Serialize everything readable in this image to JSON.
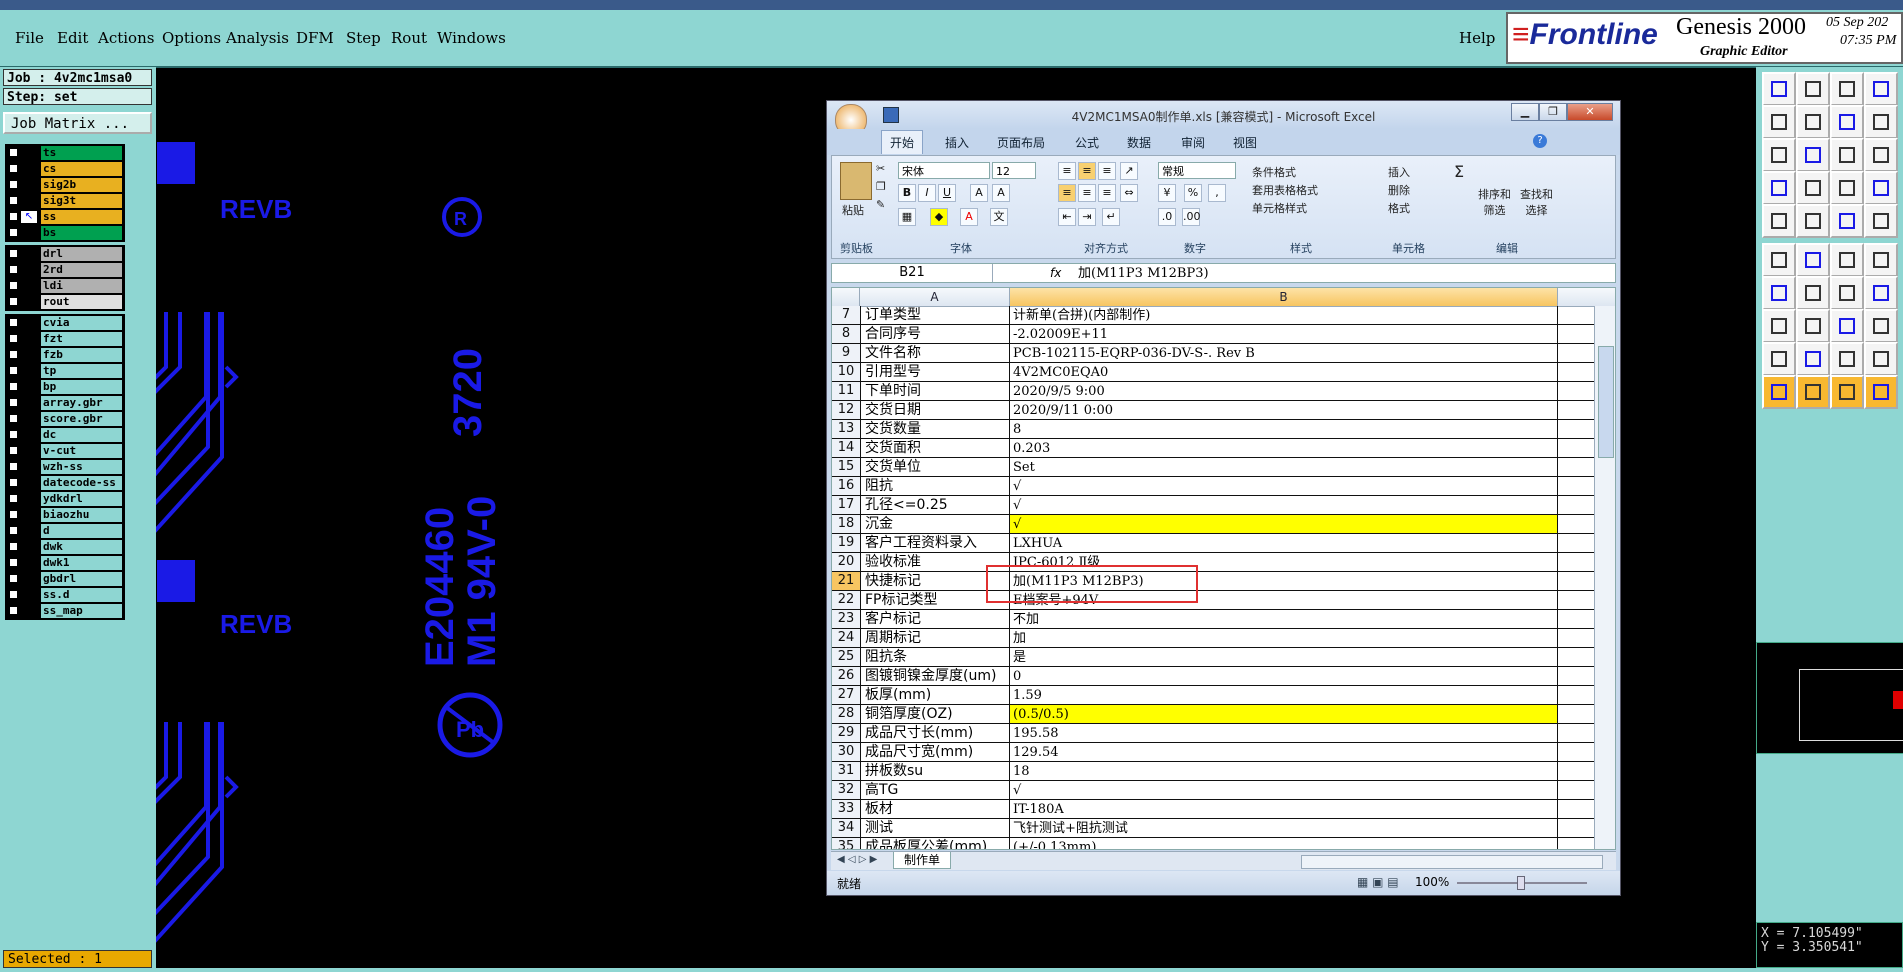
{
  "genesis": {
    "menu": [
      "File",
      "Edit",
      "Actions",
      "Options",
      "Analysis",
      "DFM",
      "Step",
      "Rout",
      "Windows"
    ],
    "help": "Help",
    "brand": {
      "logo": "Frontline",
      "product": "Genesis 2000",
      "subtitle": "Graphic Editor",
      "date": "05 Sep 202",
      "time": "07:35 PM"
    },
    "job_label": "Job : 4v2mc1msa0",
    "step_label": "Step: set",
    "job_matrix": "Job Matrix ...",
    "layers_group1": [
      {
        "name": "ts",
        "color": "#00a050"
      },
      {
        "name": "cs",
        "color": "#e8b020"
      },
      {
        "name": "sig2b",
        "color": "#e8b020"
      },
      {
        "name": "sig3t",
        "color": "#e8b020"
      },
      {
        "name": "ss",
        "color": "#e8b020"
      },
      {
        "name": "bs",
        "color": "#00a050"
      }
    ],
    "layers_group2": [
      {
        "name": "drl",
        "color": "#b0b0b0"
      },
      {
        "name": "2rd",
        "color": "#b0b0b0"
      },
      {
        "name": "ldi",
        "color": "#b0b0b0"
      },
      {
        "name": "rout",
        "color": "#e0e0e0"
      }
    ],
    "layers_group3": [
      "cvia",
      "fzt",
      "fzb",
      "tp",
      "bp",
      "array.gbr",
      "score.gbr",
      "dc",
      "v-cut",
      "wzh-ss",
      "datecode-ss",
      "ydkdrl",
      "biaozhu",
      "d",
      "dwk",
      "dwk1",
      "gbdrl",
      "ss.d",
      "ss_map"
    ],
    "selected": "Selected : 1",
    "coords": {
      "x": "X = 7.105499\"",
      "y": "Y = 3.350541\""
    },
    "canvas_text": {
      "revb1": "REVB",
      "revb2": "REVB",
      "ul_num": "E204460",
      "ul_sub": "M1 94V-0",
      "ul_code": "3720"
    }
  },
  "excel": {
    "title": "4V2MC1MSA0制作单.xls  [兼容模式] - Microsoft Excel",
    "tabs": [
      "开始",
      "插入",
      "页面布局",
      "公式",
      "数据",
      "审阅",
      "视图"
    ],
    "ribbon": {
      "paste": "粘贴",
      "clipboard": "剪贴板",
      "font": "字体",
      "alignment": "对齐方式",
      "number": "数字",
      "styles": "样式",
      "cells": "单元格",
      "editing": "编辑",
      "font_name": "宋体",
      "font_size": "12",
      "number_format": "常规",
      "cond_format": "条件格式",
      "table_format": "套用表格格式",
      "cell_styles": "单元格样式",
      "insert": "插入",
      "delete": "删除",
      "format": "格式",
      "sort_filter": "排序和\n筛选",
      "find_select": "查找和\n选择"
    },
    "name_box": "B21",
    "fx": "fx",
    "formula": "加(M11P3 M12BP3)",
    "col_a": "A",
    "col_b": "B",
    "rows": [
      {
        "n": "7",
        "a": "订单类型",
        "b": "计新单(合拼)(内部制作)",
        "y": false
      },
      {
        "n": "8",
        "a": "合同序号",
        "b": "-2.02009E+11",
        "y": false
      },
      {
        "n": "9",
        "a": "文件名称",
        "b": "PCB-102115-EQRP-036-DV-S-. Rev B",
        "y": false
      },
      {
        "n": "10",
        "a": "引用型号",
        "b": "4V2MC0EQA0",
        "y": false
      },
      {
        "n": "11",
        "a": "下单时间",
        "b": "2020/9/5 9:00",
        "y": false
      },
      {
        "n": "12",
        "a": "交货日期",
        "b": "2020/9/11 0:00",
        "y": false
      },
      {
        "n": "13",
        "a": "交货数量",
        "b": "8",
        "y": false
      },
      {
        "n": "14",
        "a": "交货面积",
        "b": "0.203",
        "y": false
      },
      {
        "n": "15",
        "a": "交货单位",
        "b": "Set",
        "y": false
      },
      {
        "n": "16",
        "a": "阻抗",
        "b": "√",
        "y": false
      },
      {
        "n": "17",
        "a": "孔径<=0.25",
        "b": "√",
        "y": false
      },
      {
        "n": "18",
        "a": "沉金",
        "b": "√",
        "y": true
      },
      {
        "n": "19",
        "a": "客户工程资料录入",
        "b": "LXHUA",
        "y": false
      },
      {
        "n": "20",
        "a": "验收标准",
        "b": "IPC-6012 Ⅱ级",
        "y": false
      },
      {
        "n": "21",
        "a": "快捷标记",
        "b": "加(M11P3 M12BP3)",
        "y": false
      },
      {
        "n": "22",
        "a": "FP标记类型",
        "b": "E档案号+94V",
        "y": false
      },
      {
        "n": "23",
        "a": "客户标记",
        "b": "不加",
        "y": false
      },
      {
        "n": "24",
        "a": "周期标记",
        "b": "加",
        "y": false
      },
      {
        "n": "25",
        "a": "阻抗条",
        "b": "是",
        "y": false
      },
      {
        "n": "26",
        "a": "图镀铜镍金厚度(um)",
        "b": "0",
        "y": false
      },
      {
        "n": "27",
        "a": "板厚(mm)",
        "b": "1.59",
        "y": false
      },
      {
        "n": "28",
        "a": "铜箔厚度(OZ)",
        "b": "(0.5/0.5)",
        "y": true
      },
      {
        "n": "29",
        "a": "成品尺寸长(mm)",
        "b": "195.58",
        "y": false
      },
      {
        "n": "30",
        "a": "成品尺寸宽(mm)",
        "b": "129.54",
        "y": false
      },
      {
        "n": "31",
        "a": "拼板数su",
        "b": "18",
        "y": false
      },
      {
        "n": "32",
        "a": "高TG",
        "b": "√",
        "y": false
      },
      {
        "n": "33",
        "a": "板材",
        "b": "IT-180A",
        "y": false
      },
      {
        "n": "34",
        "a": "测试",
        "b": "飞针测试+阻抗测试",
        "y": false
      },
      {
        "n": "35",
        "a": "成品板厚公差(mm)",
        "b": "(+/-0.13mm)",
        "y": false
      }
    ],
    "sheet_tab": "制作单",
    "status": "就绪",
    "zoom": "100%"
  }
}
